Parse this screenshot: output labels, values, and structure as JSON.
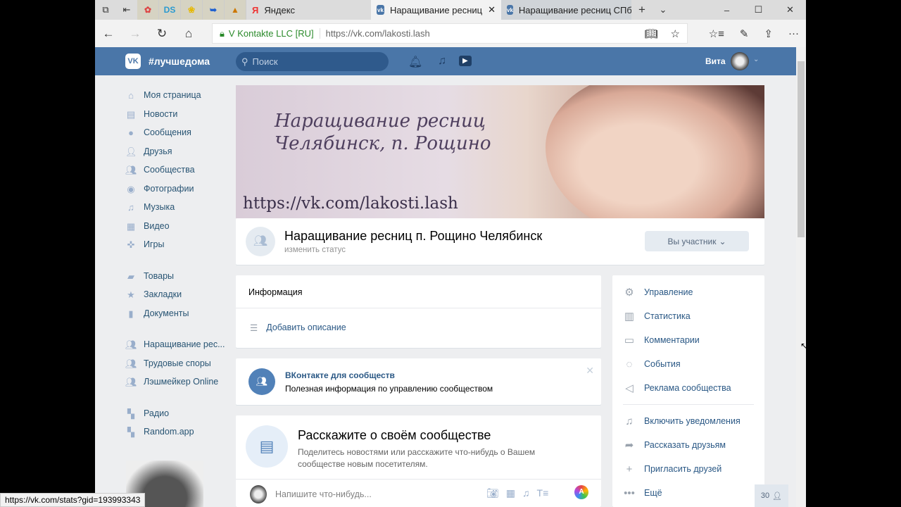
{
  "browser": {
    "tabs": [
      {
        "label": "Яндекс"
      },
      {
        "label": "Наращивание ресниц",
        "active": true
      },
      {
        "label": "Наращивание ресниц СПб"
      }
    ],
    "pinned": [
      "DS"
    ],
    "cert": "V Kontakte LLC [RU]",
    "url": "https://vk.com/lakosti.lash",
    "status_url": "https://vk.com/stats?gid=193993343"
  },
  "vk": {
    "logo": "VK",
    "hashtag": "#лучшедома",
    "search_placeholder": "Поиск",
    "user": "Вита",
    "accent": "#4a76a8"
  },
  "leftnav": [
    {
      "label": "Моя страница",
      "icon": "home-icon"
    },
    {
      "label": "Новости",
      "icon": "news-icon"
    },
    {
      "label": "Сообщения",
      "icon": "messages-icon"
    },
    {
      "label": "Друзья",
      "icon": "friends-icon"
    },
    {
      "label": "Сообщества",
      "icon": "groups-icon"
    },
    {
      "label": "Фотографии",
      "icon": "photo-icon"
    },
    {
      "label": "Музыка",
      "icon": "music-icon"
    },
    {
      "label": "Видео",
      "icon": "video-icon"
    },
    {
      "label": "Игры",
      "icon": "games-icon"
    },
    {
      "label": "Товары",
      "icon": "bag-icon"
    },
    {
      "label": "Закладки",
      "icon": "star-icon"
    },
    {
      "label": "Документы",
      "icon": "doc-icon"
    },
    {
      "label": "Наращивание рес...",
      "icon": "group-icon"
    },
    {
      "label": "Трудовые споры",
      "icon": "group-icon"
    },
    {
      "label": "Лэшмейкер Online",
      "icon": "group-icon"
    },
    {
      "label": "Радио",
      "icon": "app-icon"
    },
    {
      "label": "Random.app",
      "icon": "app-icon"
    }
  ],
  "cover": {
    "line1": "Наращивание ресниц",
    "line2": "Челябинск, п. Рощино",
    "url": "https://vk.com/lakosti.lash"
  },
  "group": {
    "name": "Наращивание ресниц п. Рощино Челябинск",
    "status": "изменить статус",
    "member_btn": "Вы участник"
  },
  "info": {
    "title": "Информация",
    "add_desc": "Добавить описание"
  },
  "promo": {
    "title": "ВКонтакте для сообществ",
    "text": "Полезная информация по управлению сообществом"
  },
  "tell": {
    "title": "Расскажите о своём сообществе",
    "text": "Поделитесь новостями или расскажите что-нибудь о Вашем сообществе новым посетителям.",
    "post_placeholder": "Напишите что-нибудь..."
  },
  "right_menu": [
    {
      "label": "Управление",
      "icon": "⚙"
    },
    {
      "label": "Статистика",
      "icon": "▥"
    },
    {
      "label": "Комментарии",
      "icon": "▭"
    },
    {
      "label": "События",
      "icon": "◌"
    },
    {
      "label": "Реклама сообщества",
      "icon": "◁"
    }
  ],
  "right_menu2": [
    {
      "label": "Включить уведомления",
      "icon": "♫"
    },
    {
      "label": "Рассказать друзьям",
      "icon": "➦"
    },
    {
      "label": "Пригласить друзей",
      "icon": "+"
    },
    {
      "label": "Ещё",
      "icon": "•••"
    }
  ],
  "online_count": "30"
}
